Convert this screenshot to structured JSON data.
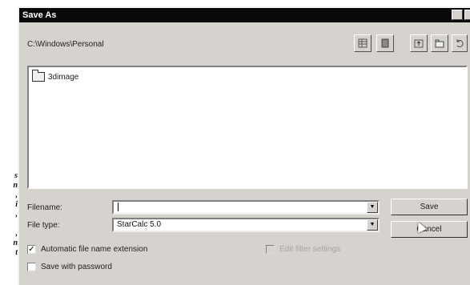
{
  "margin_text": [
    "s",
    "n",
    ",",
    "i",
    ",",
    "",
    ",",
    "n",
    "t"
  ],
  "dialog": {
    "title": "Save As",
    "path": "C:\\Windows\\Personal",
    "toolbar_icons": [
      "details-view-icon",
      "list-view-icon",
      "up-folder-icon",
      "new-folder-icon",
      "refresh-icon"
    ],
    "files": [
      {
        "name": "3dimage",
        "icon": "folder-icon"
      }
    ],
    "filename": {
      "label": "Filename:",
      "value": ""
    },
    "filetype": {
      "label": "File type:",
      "value": "StarCalc 5.0"
    },
    "buttons": {
      "save": "Save",
      "cancel": "Cancel"
    },
    "auto_extension": {
      "label": "Automatic file name extension",
      "checked": true
    },
    "filter_settings": {
      "label": "Edit filter settings",
      "enabled": false
    },
    "password": {
      "label": "Save with password",
      "checked": false
    }
  }
}
